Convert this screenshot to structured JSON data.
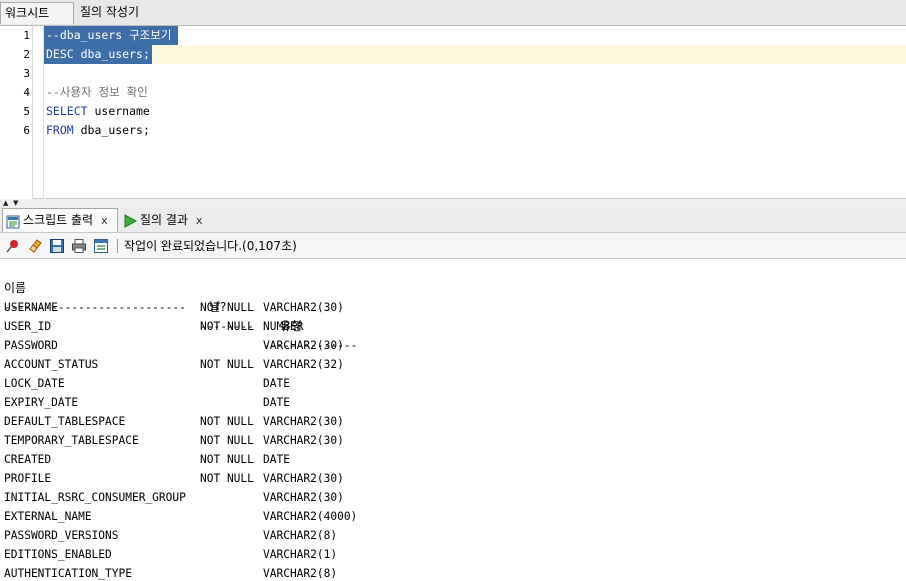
{
  "top_tabs": {
    "worksheet": "워크시트",
    "query_builder": "질의 작성기"
  },
  "editor": {
    "line_numbers": [
      "1",
      "2",
      "3",
      "4",
      "5",
      "6"
    ],
    "lines": [
      {
        "text": "--dba_users 구조보기"
      },
      {
        "kw": "DESC",
        "rest": " dba_users;"
      },
      {
        "text": ""
      },
      {
        "text": "--사용자 정보 확인"
      },
      {
        "kw": "SELECT",
        "rest": " username"
      },
      {
        "kw": "FROM",
        "rest": " dba_users;"
      }
    ]
  },
  "bottom_tabs": {
    "script_output": "스크립트 출력",
    "query_result": "질의 결과",
    "close": "x"
  },
  "toolbar": {
    "status": "작업이 완료되었습니다.(0,107초)"
  },
  "output": {
    "headers": {
      "name": "이름",
      "null": "널?",
      "type": "유형"
    },
    "dashes": {
      "name": "---------------------------",
      "null": "--------",
      "type": "--------------"
    },
    "rows": [
      {
        "name": "USERNAME",
        "null": "NOT NULL",
        "type": "VARCHAR2(30)"
      },
      {
        "name": "USER_ID",
        "null": "NOT NULL",
        "type": "NUMBER"
      },
      {
        "name": "PASSWORD",
        "null": "",
        "type": "VARCHAR2(30)"
      },
      {
        "name": "ACCOUNT_STATUS",
        "null": "NOT NULL",
        "type": "VARCHAR2(32)"
      },
      {
        "name": "LOCK_DATE",
        "null": "",
        "type": "DATE"
      },
      {
        "name": "EXPIRY_DATE",
        "null": "",
        "type": "DATE"
      },
      {
        "name": "DEFAULT_TABLESPACE",
        "null": "NOT NULL",
        "type": "VARCHAR2(30)"
      },
      {
        "name": "TEMPORARY_TABLESPACE",
        "null": "NOT NULL",
        "type": "VARCHAR2(30)"
      },
      {
        "name": "CREATED",
        "null": "NOT NULL",
        "type": "DATE"
      },
      {
        "name": "PROFILE",
        "null": "NOT NULL",
        "type": "VARCHAR2(30)"
      },
      {
        "name": "INITIAL_RSRC_CONSUMER_GROUP",
        "null": "",
        "type": "VARCHAR2(30)"
      },
      {
        "name": "EXTERNAL_NAME",
        "null": "",
        "type": "VARCHAR2(4000)"
      },
      {
        "name": "PASSWORD_VERSIONS",
        "null": "",
        "type": "VARCHAR2(8)"
      },
      {
        "name": "EDITIONS_ENABLED",
        "null": "",
        "type": "VARCHAR2(1)"
      },
      {
        "name": "AUTHENTICATION_TYPE",
        "null": "",
        "type": "VARCHAR2(8)"
      }
    ]
  },
  "colors": {
    "selection": "#3d6ea8",
    "current_line": "#fdf7dc",
    "keyword": "#1d3ea3",
    "comment": "#6f6f6f"
  },
  "icons": [
    "pin-icon",
    "eraser-icon",
    "save-icon",
    "print-icon",
    "export-icon",
    "run-play-icon",
    "script-output-icon"
  ]
}
